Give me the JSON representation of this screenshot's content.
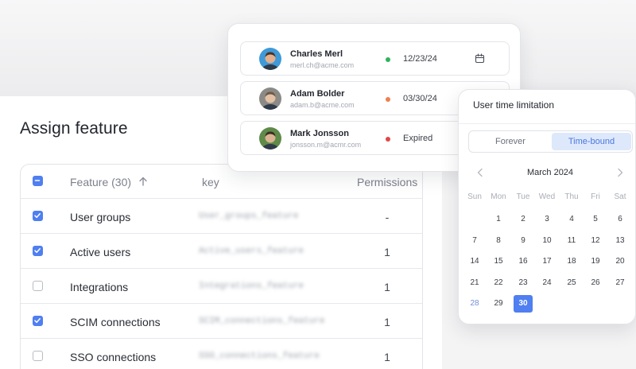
{
  "page": {
    "title": "Assign feature"
  },
  "table": {
    "headers": {
      "feature": "Feature (30)",
      "key": "key",
      "permissions": "Permissions"
    },
    "rows": [
      {
        "name": "User groups",
        "key": "User_groups_feature",
        "permissions": "-",
        "checked": true
      },
      {
        "name": "Active users",
        "key": "Active_users_feature",
        "permissions": "1",
        "checked": true
      },
      {
        "name": "Integrations",
        "key": "Integrations_feature",
        "permissions": "1",
        "checked": false
      },
      {
        "name": "SCIM connections",
        "key": "SCIM_connections_feature",
        "permissions": "1",
        "checked": true
      },
      {
        "name": "SSO connections",
        "key": "SSO_connections_feature",
        "permissions": "1",
        "checked": false
      }
    ]
  },
  "users": [
    {
      "name": "Charles Merl",
      "email": "merl.ch@acme.com",
      "status_color": "#2fb35b",
      "date": "12/23/24",
      "avatar_bg": "#3f9ad8",
      "avatar_skin": "#e2b08e",
      "avatar_hair": "#4a3428"
    },
    {
      "name": "Adam Bolder",
      "email": "adam.b@acme.com",
      "status_color": "#ef7f4f",
      "date": "03/30/24",
      "avatar_bg": "#8b8a86",
      "avatar_skin": "#e3c1a4",
      "avatar_hair": "#6b5a4a"
    },
    {
      "name": "Mark Jonsson",
      "email": "jonsson.m@acmr.com",
      "status_color": "#e04848",
      "date": "Expired",
      "avatar_bg": "#5f8a4a",
      "avatar_skin": "#d9b392",
      "avatar_hair": "#3a2e24"
    }
  ],
  "time_limitation": {
    "title": "User time limitation",
    "options": {
      "forever": "Forever",
      "time_bound": "Time-bound"
    },
    "selected_option": "Time-bound",
    "month": "March 2024",
    "weekdays": [
      "Sun",
      "Mon",
      "Tue",
      "Wed",
      "Thu",
      "Fri",
      "Sat"
    ],
    "weeks": [
      [
        "",
        "1",
        "2",
        "3",
        "4",
        "5",
        "6"
      ],
      [
        "7",
        "8",
        "9",
        "10",
        "11",
        "12",
        "13"
      ],
      [
        "14",
        "15",
        "16",
        "17",
        "18",
        "19",
        "20"
      ],
      [
        "21",
        "22",
        "23",
        "24",
        "25",
        "26",
        "27"
      ],
      [
        "28",
        "29",
        "30",
        "",
        "",
        "",
        ""
      ]
    ],
    "selected_day": "30",
    "today": "28"
  },
  "colors": {
    "accent": "#4f7ff0",
    "accent_light": "#dde8fb"
  }
}
